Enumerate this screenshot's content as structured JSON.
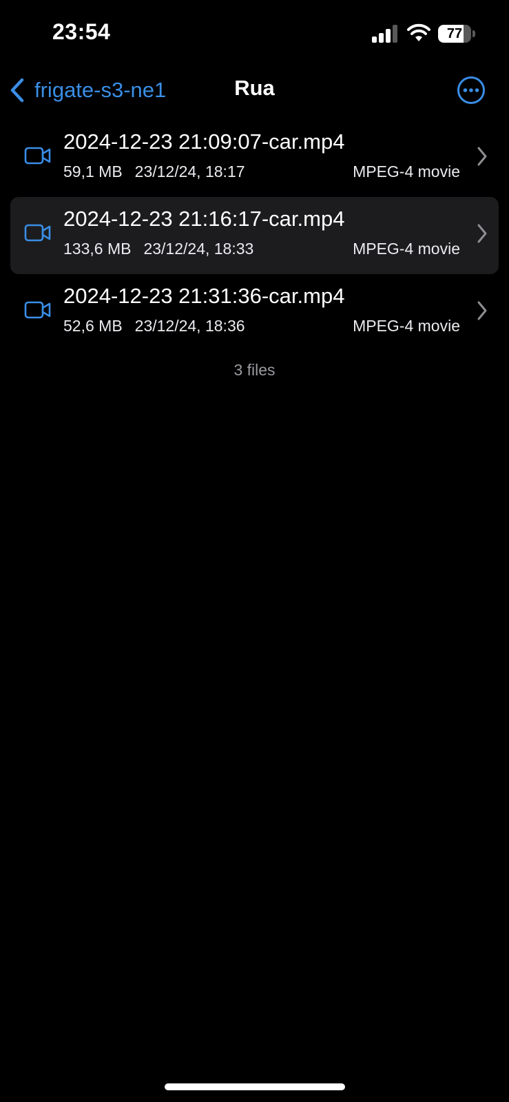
{
  "status_bar": {
    "time": "23:54",
    "battery_level": "77",
    "battery_fraction": 0.77,
    "signal_icon": "cellular-signal-icon",
    "wifi_icon": "wifi-icon"
  },
  "nav": {
    "back_label": "frigate-s3-ne1",
    "title": "Rua",
    "back_icon": "chevron-left-icon",
    "more_icon": "ellipsis-circle-icon"
  },
  "files": [
    {
      "name": "2024-12-23 21:09:07-car.mp4",
      "size": "59,1 MB",
      "date": "23/12/24, 18:17",
      "kind": "MPEG-4 movie",
      "selected": false,
      "icon": "video-camera-icon"
    },
    {
      "name": "2024-12-23 21:16:17-car.mp4",
      "size": "133,6 MB",
      "date": "23/12/24, 18:33",
      "kind": "MPEG-4 movie",
      "selected": true,
      "icon": "video-camera-icon"
    },
    {
      "name": "2024-12-23 21:31:36-car.mp4",
      "size": "52,6 MB",
      "date": "23/12/24, 18:36",
      "kind": "MPEG-4 movie",
      "selected": false,
      "icon": "video-camera-icon"
    }
  ],
  "footer": {
    "count_label": "3 files"
  },
  "colors": {
    "accent": "#3a8ee6",
    "background": "#000000",
    "selected_row": "#1c1c1e"
  }
}
